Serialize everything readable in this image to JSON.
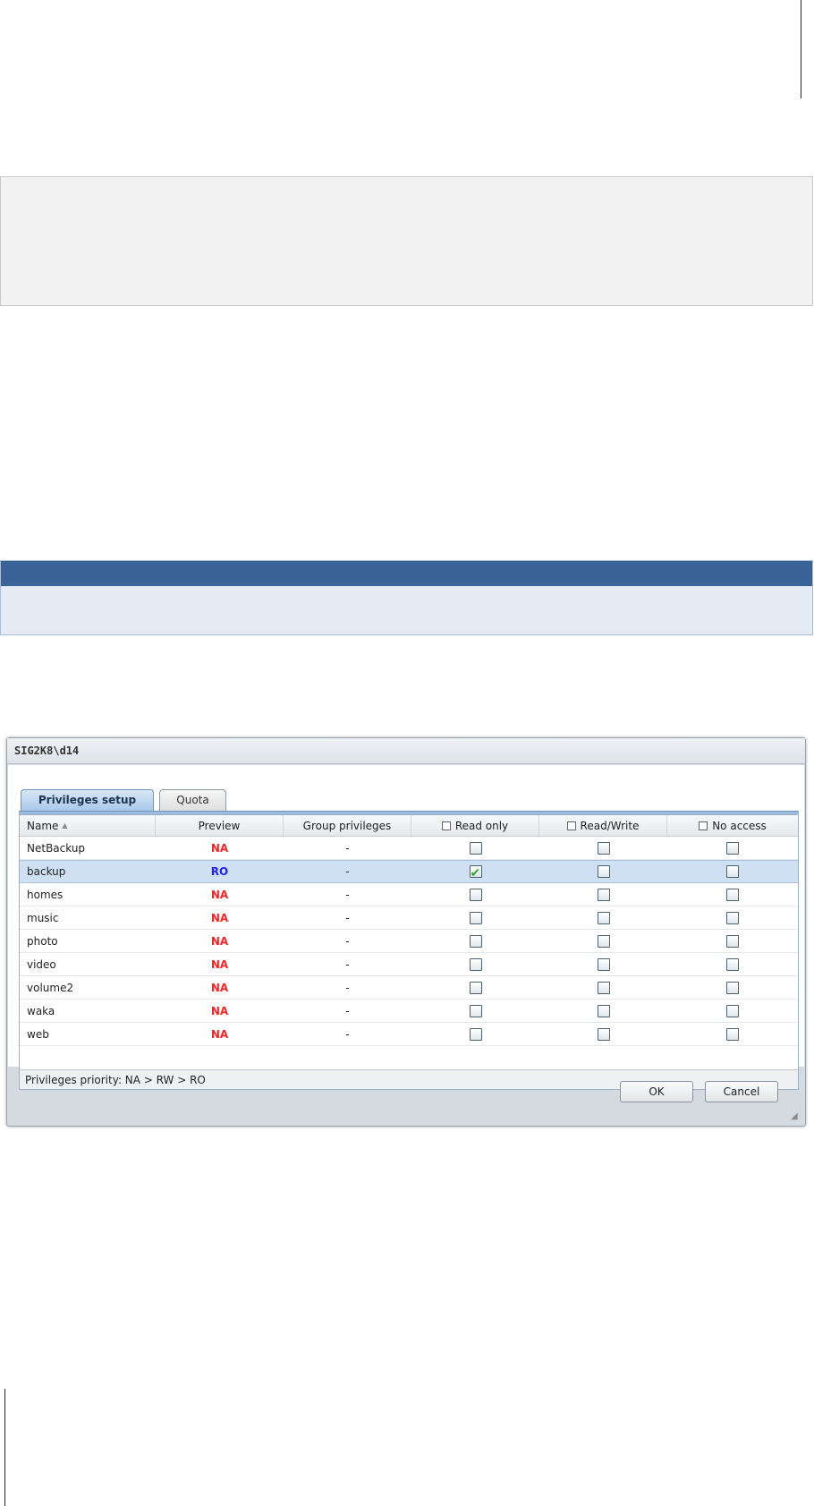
{
  "dialog": {
    "title": "SIG2K8\\d14",
    "tabs": [
      {
        "label": "Privileges setup",
        "active": true
      },
      {
        "label": "Quota",
        "active": false
      }
    ],
    "columns": {
      "name": "Name",
      "preview": "Preview",
      "group": "Group privileges",
      "read_only": "Read only",
      "read_write": "Read/Write",
      "no_access": "No access"
    },
    "rows": [
      {
        "name": "NetBackup",
        "preview": "NA",
        "group": "-",
        "ro": false,
        "rw": false,
        "na": false,
        "selected": false
      },
      {
        "name": "backup",
        "preview": "RO",
        "group": "-",
        "ro": true,
        "rw": false,
        "na": false,
        "selected": true
      },
      {
        "name": "homes",
        "preview": "NA",
        "group": "-",
        "ro": false,
        "rw": false,
        "na": false,
        "selected": false
      },
      {
        "name": "music",
        "preview": "NA",
        "group": "-",
        "ro": false,
        "rw": false,
        "na": false,
        "selected": false
      },
      {
        "name": "photo",
        "preview": "NA",
        "group": "-",
        "ro": false,
        "rw": false,
        "na": false,
        "selected": false
      },
      {
        "name": "video",
        "preview": "NA",
        "group": "-",
        "ro": false,
        "rw": false,
        "na": false,
        "selected": false
      },
      {
        "name": "volume2",
        "preview": "NA",
        "group": "-",
        "ro": false,
        "rw": false,
        "na": false,
        "selected": false
      },
      {
        "name": "waka",
        "preview": "NA",
        "group": "-",
        "ro": false,
        "rw": false,
        "na": false,
        "selected": false
      },
      {
        "name": "web",
        "preview": "NA",
        "group": "-",
        "ro": false,
        "rw": false,
        "na": false,
        "selected": false
      }
    ],
    "footer": "Privileges priority: NA > RW > RO",
    "ok_label": "OK",
    "cancel_label": "Cancel"
  },
  "colors": {
    "accent_band": "#3a6497",
    "band_body": "#e5ebf5",
    "preview_na": "#ff2222",
    "preview_ro": "#2222ee",
    "check_green": "#2fa82f"
  },
  "icons": {
    "sort": "sort-ascending-icon",
    "check": "checkmark-icon",
    "resize": "resize-grip-icon"
  }
}
